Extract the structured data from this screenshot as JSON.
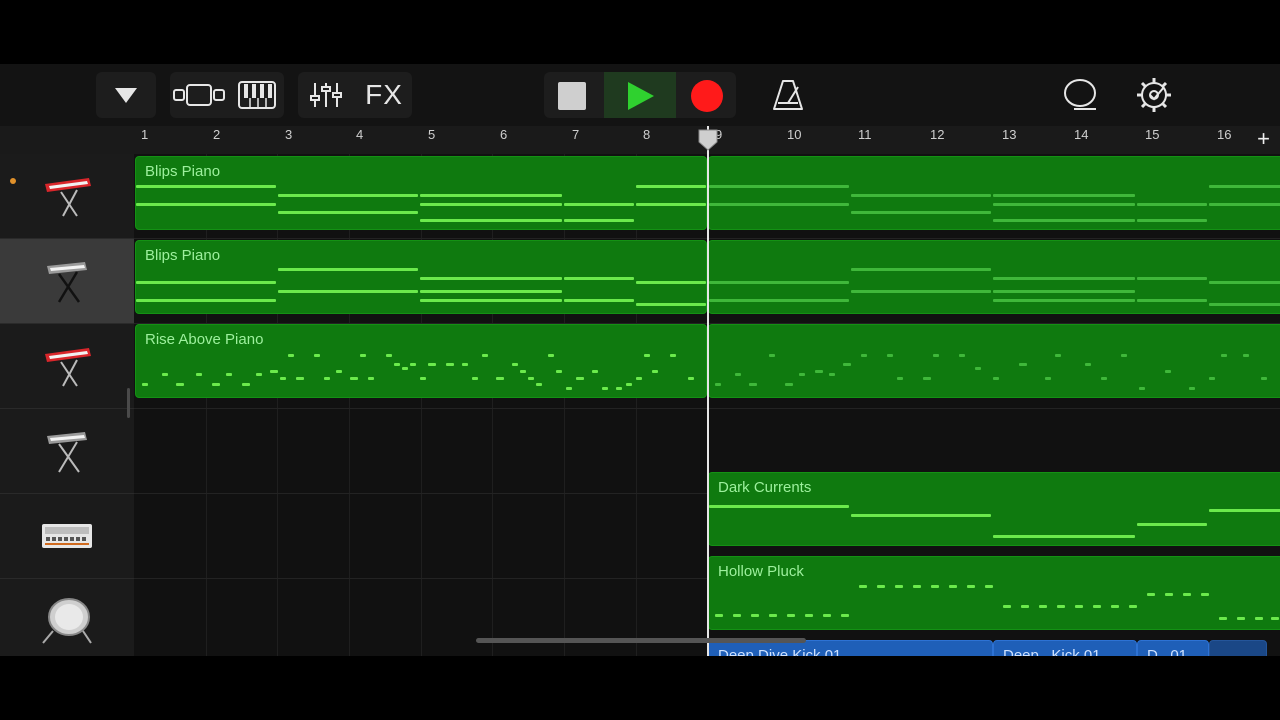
{
  "toolbar": {
    "fx_label": "FX",
    "colors": {
      "record": "#ff1a1a",
      "play": "#2fd12f",
      "play_bg": "#1f3a1f"
    }
  },
  "ruler": {
    "bars": [
      "1",
      "2",
      "3",
      "4",
      "5",
      "6",
      "7",
      "8",
      "9",
      "10",
      "11",
      "12",
      "13",
      "14",
      "15",
      "16"
    ],
    "add_label": "+"
  },
  "tracks": [
    {
      "instrument": "red-keyboard-icon",
      "region": "Blips Piano"
    },
    {
      "instrument": "keyboard-stand-icon",
      "region": "Blips Piano"
    },
    {
      "instrument": "red-keyboard-icon",
      "region": "Rise Above Piano"
    },
    {
      "instrument": "keyboard-stand-icon",
      "region": "Dark Currents"
    },
    {
      "instrument": "drum-machine-icon",
      "region": "Hollow Pluck"
    },
    {
      "instrument": "drum-icon",
      "regions": [
        "Deep Dive Kick 01",
        "Deep...Kick 01",
        "D...01"
      ]
    }
  ]
}
